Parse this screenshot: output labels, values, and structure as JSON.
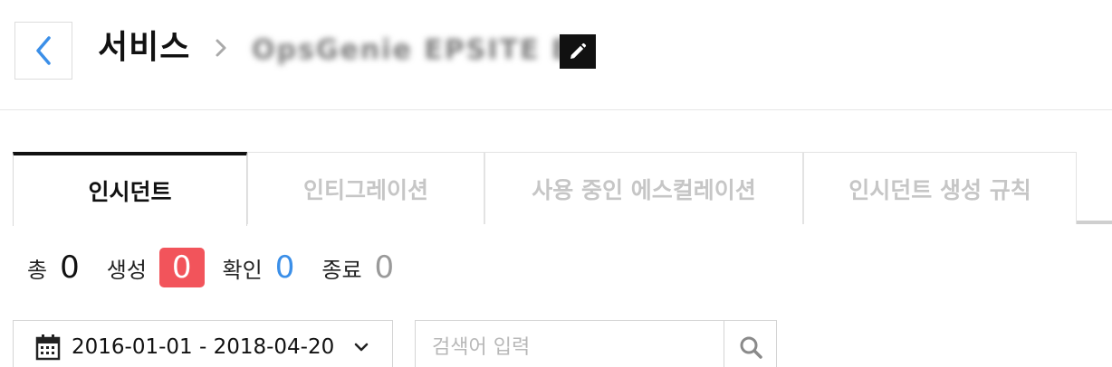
{
  "header": {
    "title": "서비스",
    "service_name": "OpsGenie EPSITE BI"
  },
  "tabs": [
    {
      "label": "인시던트",
      "active": true
    },
    {
      "label": "인티그레이션",
      "active": false
    },
    {
      "label": "사용 중인 에스컬레이션",
      "active": false
    },
    {
      "label": "인시던트 생성 규칙",
      "active": false
    }
  ],
  "counts": {
    "total_label": "총",
    "total": "0",
    "new_label": "생성",
    "new": "0",
    "ack_label": "확인",
    "ack": "0",
    "closed_label": "종료",
    "closed": "0"
  },
  "filters": {
    "date_range": "2016-01-01 - 2018-04-20",
    "search_placeholder": "검색어 입력"
  },
  "colors": {
    "new_badge": "#f2545b",
    "ack": "#3b8fe8",
    "back_chevron": "#3b8fe8"
  }
}
